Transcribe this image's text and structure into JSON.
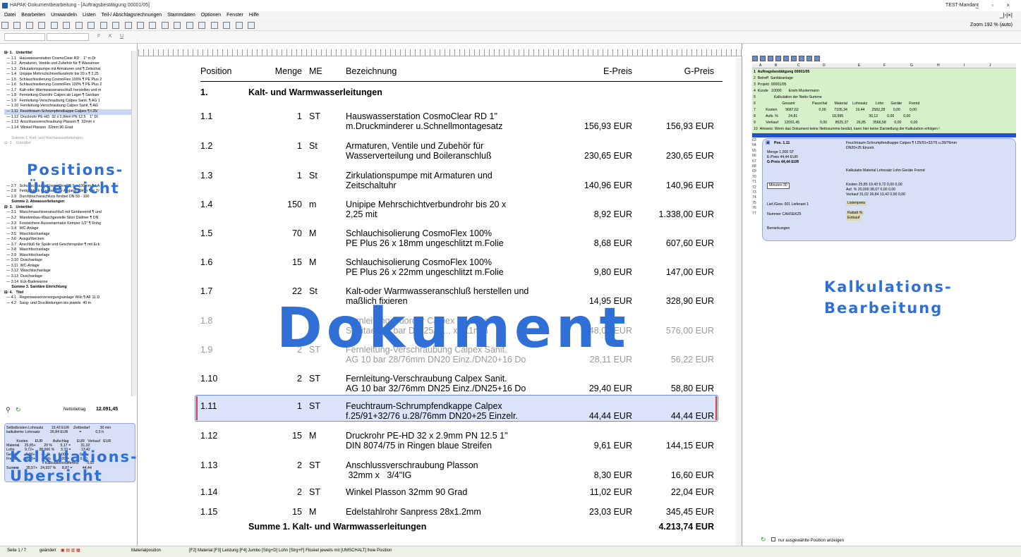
{
  "window": {
    "title": "HAPAK-Dokumentbearbeitung - [Auftragsbestätigung 00001/05]",
    "mandant": "TEST-Mandant",
    "controls": "_ ▫ ×"
  },
  "menu": {
    "items": [
      "Datei",
      "Bearbeiten",
      "Umwandeln",
      "Listen",
      "Teil-/ Abschlagsrechnungen",
      "Stammdaten",
      "Optionen",
      "Fenster",
      "Hilfe"
    ],
    "mdi_controls": "_|▫|×|"
  },
  "toolbar": {
    "zoom_label": "Zoom",
    "zoom_value": "192 % (auto)"
  },
  "format_toolbar": {
    "bold": "F",
    "italic": "K",
    "underline": "U"
  },
  "tree": {
    "rows": [
      {
        "text": "⊟· 1.   Untertitel",
        "style": "bold"
      },
      {
        "text": "  — 1.1   Hauswasserstation CosmoClear RD    1\" m.Dr",
        "style": ""
      },
      {
        "text": "  — 1.2   Armaturen, Ventile und Zubehör für ¶ Wasserver",
        "style": ""
      },
      {
        "text": "  — 1.3   Zirkulationspumpe mit Armaturen und ¶ Zeitschal",
        "style": ""
      },
      {
        "text": "  — 1.4   Unipipe Mehrschichtverbundrohr bis 20 x ¶ 2,25",
        "style": ""
      },
      {
        "text": "  — 1.5   Schlauchisolierung CosmoFlex 100% ¶ PE Plus 2",
        "style": ""
      },
      {
        "text": "  — 1.6   Schlauchisolierung CosmoFlex 100% ¶ PE Plus 2",
        "style": ""
      },
      {
        "text": "  — 1.7   Kalt-oder Warmwasseranschluß herstellen und m",
        "style": ""
      },
      {
        "text": "  — 1.8   Fernleitung-Duorohr Calpex ab Lager ¶ Sanitaer",
        "style": ""
      },
      {
        "text": "  — 1.9   Fernleitung-Verschraubung Calpex Sanit. ¶ AG 1",
        "style": ""
      },
      {
        "text": "  — 1.10  Fernleitung-Verschraubung Calpex Sanit. ¶ AG",
        "style": ""
      },
      {
        "text": "  — 1.11  Feuchtraum-Schrumpfendkappe Calpex ¶ f.25/",
        "style": "sel"
      },
      {
        "text": "  — 1.12  Druckrohr PE-HD  32 x 2,9mm PN 12.5    1\" DI",
        "style": ""
      },
      {
        "text": "  — 1.13  Anschlussverschraubung Plasson ¶  32mm x",
        "style": ""
      },
      {
        "text": "  — 1.14  Winkel Plasson  32mm 90 Grad",
        "style": ""
      },
      {
        "text": "",
        "style": ""
      },
      {
        "text": "       Summe 1. Kalt- und Warmwasserleitungen",
        "style": "grey"
      },
      {
        "text": "⊟· 2.   Untertitel",
        "style": "grey"
      },
      {
        "text": "",
        "style": ""
      },
      {
        "text": "",
        "style": ""
      },
      {
        "text": "",
        "style": ""
      },
      {
        "text": "",
        "style": ""
      },
      {
        "text": "",
        "style": ""
      },
      {
        "text": "",
        "style": ""
      },
      {
        "text": "",
        "style": ""
      },
      {
        "text": "  — 2.7   Schutzschlauch CosmoFlex PE 5 x 100mm ¶ LA",
        "style": ""
      },
      {
        "text": "  — 2.8   Fertigeblock f.Leckwasser Abgang 50mm ¶ m.Tr",
        "style": ""
      },
      {
        "text": "  — 2.9   Durchbruchanschluss flexibel DN 50 - 100",
        "style": ""
      },
      {
        "text": "       Summe 2. Abwasserleitungen",
        "style": "bold"
      },
      {
        "text": "⊟· 3.   Untertitel",
        "style": "bold"
      },
      {
        "text": "  — 3.1   Waschmaschinenanschluß mit Geräteventil ¶ und",
        "style": ""
      },
      {
        "text": "  — 3.2   Wandeinbau-Waschgestelle Silon Dallmer ¶ DN",
        "style": ""
      },
      {
        "text": "  — 3.3   Frostsichere Aussenarmatur Kemper 1/2\" ¶ Rohg",
        "style": ""
      },
      {
        "text": "  — 3.4   WC-Anlage",
        "style": ""
      },
      {
        "text": "  — 3.5   Waschtischanlage",
        "style": ""
      },
      {
        "text": "  — 3.6   Ausgußbecken",
        "style": ""
      },
      {
        "text": "  — 3.7   Anschluß für Spüle und Geschirrspüler ¶ mit Eck",
        "style": ""
      },
      {
        "text": "  — 3.8   Waschtischanlage",
        "style": ""
      },
      {
        "text": "  — 3.9   Waschtischanlage",
        "style": ""
      },
      {
        "text": "  — 3.10  Duschanlage",
        "style": ""
      },
      {
        "text": "  — 3.11  WC-Anlage",
        "style": ""
      },
      {
        "text": "  — 3.12  Waschtischanlage",
        "style": ""
      },
      {
        "text": "  — 3.13  Duschanlage",
        "style": ""
      },
      {
        "text": "  — 3.14  Eck-Badewanne",
        "style": ""
      },
      {
        "text": "       Summe 3. Sanitäre Einrichtung",
        "style": "bold"
      },
      {
        "text": "⊟· 4.   Titel",
        "style": "bold"
      },
      {
        "text": "  — 4.1   Regenwasserversorgungsanlage Wilo ¶ AF 11 D",
        "style": ""
      },
      {
        "text": "  — 4.2   Saug- und Druckleitungen bis jeweils  40 m",
        "style": ""
      }
    ]
  },
  "net": {
    "label": "Nettobetrag",
    "value": "12.091,45"
  },
  "kalk_overview": {
    "rows": [
      "Selbstkosten Lohnsatz        19,43 EUR    Zeitbedarf          30 min",
      "kalkulierter Lohnsatz          26,84 EUR           =              0,5 h",
      "",
      "          Kosten       EUR          Aufschlag        EUR   Verkauf   EUR",
      "Material     25,85+        20 %        5,17 =          31,02",
      "Lohn          9,72+     38,066 %      3,70 =          13,42",
      "Geräte        0,00+      ---- %        0,00 =           0,00",
      "Fremd         0,00+      ---- %        0,00 =           0,00",
      "                                   + Kalkulationsdifferenz        0,00",
      "Summe       35,57+   24,937 %      8,87 =          44,44"
    ]
  },
  "overlays": {
    "positions": "Positions-\nÜbersicht",
    "dokument": "Dokument",
    "kalk_ueber": "Kalkulations-\nÜbersicht",
    "kalk_bearb": "Kalkulations-\nBearbeitung"
  },
  "doc": {
    "headers": {
      "pos": "Position",
      "menge": "Menge",
      "me": "ME",
      "bez": "Bezeichnung",
      "ep": "E-Preis",
      "gp": "G-Preis"
    },
    "group_pos": "1.",
    "group_title": "Kalt- und Warmwasserleitungen",
    "rows": [
      {
        "pos": "1.1",
        "menge": "1",
        "me": "ST",
        "bez1": "Hauswasserstation CosmoClear RD     1\"",
        "bez2": "m.Druckminderer u.Schnellmontagesatz",
        "ep": "156,93 EUR",
        "gp": "156,93 EUR"
      },
      {
        "pos": "1.2",
        "menge": "1",
        "me": "St",
        "bez1": "Armaturen, Ventile und Zubehör für",
        "bez2": "Wasserverteilung und Boileranschluß",
        "ep": "230,65 EUR",
        "gp": "230,65 EUR"
      },
      {
        "pos": "1.3",
        "menge": "1",
        "me": "St",
        "bez1": "Zirkulationspumpe mit Armaturen und",
        "bez2": "Zeitschaltuhr",
        "ep": "140,96 EUR",
        "gp": "140,96 EUR"
      },
      {
        "pos": "1.4",
        "menge": "150",
        "me": "m",
        "bez1": "Unipipe Mehrschichtverbundrohr bis 20 x",
        "bez2": "2,25 mit",
        "ep": "8,92 EUR",
        "gp": "1.338,00 EUR"
      },
      {
        "pos": "1.5",
        "menge": "70",
        "me": "M",
        "bez1": "Schlauchisolierung CosmoFlex 100%",
        "bez2": "PE Plus 26 x 18mm ungeschlitzt m.Folie",
        "ep": "8,68 EUR",
        "gp": "607,60 EUR"
      },
      {
        "pos": "1.6",
        "menge": "15",
        "me": "M",
        "bez1": "Schlauchisolierung CosmoFlex 100%",
        "bez2": "PE Plus 26 x 22mm ungeschlitzt m.Folie",
        "ep": "9,80 EUR",
        "gp": "147,00 EUR"
      },
      {
        "pos": "1.7",
        "menge": "22",
        "me": "St",
        "bez1": "Kalt-oder Warmwasseranschluß herstellen und",
        "bez2": "maßlich fixieren",
        "ep": "14,95 EUR",
        "gp": "328,90 EUR"
      },
      {
        "pos": "1.8",
        "menge": "",
        "me": "M",
        "bez1": "Fernleitung-Duorohr Calpex ab Lager",
        "bez2": "Sanitaer 10 bar DN 25/2.... x 111mm",
        "ep": "48,00 EUR",
        "gp": "576,00 EUR",
        "faded": true
      },
      {
        "pos": "1.9",
        "menge": "2",
        "me": "ST",
        "bez1": "Fernleitung-Verschraubung Calpex Sanit.",
        "bez2": "AG 10 bar 28/76mm DN20 Einz./DN20+16 Do",
        "ep": "28,11 EUR",
        "gp": "56,22 EUR",
        "faded": true
      },
      {
        "pos": "1.10",
        "menge": "2",
        "me": "ST",
        "bez1": "Fernleitung-Verschraubung Calpex Sanit.",
        "bez2": "AG 10 bar 32/76mm DN25 Einz./DN25+16 Do",
        "ep": "29,40 EUR",
        "gp": "58,80 EUR"
      },
      {
        "pos": "1.11",
        "menge": "1",
        "me": "ST",
        "bez1": "Feuchtraum-Schrumpfendkappe Calpex",
        "bez2": "f.25/91+32/76 u.28/76mm DN20+25 Einzelr.",
        "ep": "44,44 EUR",
        "gp": "44,44 EUR"
      },
      {
        "pos": "1.12",
        "menge": "15",
        "me": "M",
        "bez1": "Druckrohr PE-HD  32 x 2.9mm PN 12.5     1\"",
        "bez2": "DIN 8074/75 in Ringen blaue Streifen",
        "ep": "9,61 EUR",
        "gp": "144,15 EUR"
      },
      {
        "pos": "1.13",
        "menge": "2",
        "me": "ST",
        "bez1": "Anschlussverschraubung Plasson",
        "bez2": " 32mm x   3/4\"IG",
        "ep": "8,30 EUR",
        "gp": "16,60 EUR"
      },
      {
        "pos": "1.14",
        "menge": "2",
        "me": "ST",
        "bez1": "Winkel Plasson  32mm 90 Grad",
        "bez2": "",
        "ep": "11,02 EUR",
        "gp": "22,04 EUR"
      },
      {
        "pos": "1.15",
        "menge": "15",
        "me": "M",
        "bez1": "Edelstahlrohr Sanpress 28x1.2mm",
        "bez2": "",
        "ep": "23,03 EUR",
        "gp": "345,45 EUR"
      }
    ],
    "sum_label": "Summe 1. Kalt- und Warmwasserleitungen",
    "sum_value": "4.213,74 EUR"
  },
  "sheet": {
    "col_letters": [
      "A",
      "B",
      "C",
      "D",
      "E",
      "F",
      "G",
      "H",
      "I",
      "J"
    ],
    "rows": [
      "1  Auftragsbestätigung 00001/05",
      "2  Betreff  Sanitäranlage",
      "3  Projekt  00001/05",
      "4  Kunde   10000       Erwin Mustermann",
      "5                  Kalkulation der Netto-Summe",
      "6                          Gesamt                 Pauschal       Material     Lohnsatz        Lohn       Geräte       Fremd",
      "7          Kosten        9687,62                    0,00        7105,34        19,44       2582,28        0,00         0,00",
      "8          Aufs. %          24,81                                  18,995                         30,12         0,00         0,00",
      "9          Verkauf      12091,45                    0,00        8525,37        26,85       3566,58        0,00         0,00",
      "10  Hinweis: Wenn das Dokument keine Nettosumme besitzt, kann hier keine Darstellung der Kalkulation erfolgen !"
    ]
  },
  "pane2": {
    "rownums": [
      "63",
      "64",
      "65",
      "66",
      "67",
      "68",
      "69",
      "70",
      "71",
      "72",
      "73",
      "74",
      "75",
      "76",
      "77"
    ],
    "pos_label": "Pos.  1.11",
    "desc": "Feuchtraum-Schrumpfendkappe Calpex ¶ f.25/91+32/76 u.28/76mm",
    "desc2": "DN20+25 Einzelr.",
    "menge": "Menge           1,000  ST",
    "epreis": "E-Preis            44,44  EUR",
    "gpreis": "G-Preis            44,44  EUR",
    "kalk_hdr": "Kalkulatio    Material    Lohnsatz      Lohn       Geräte      Fremd",
    "minuten": "Minuten                 30",
    "kosten": "Kosten        25,85       19,43        9,72         0,00         0,00",
    "aufs": "Auf. %        20,000                    38,07        0,00         0,00",
    "verkauf": "Verkauf       31,02       26,84       13,42         0,00         0,00",
    "lief": "Lief./Gew.    001 Lieferant 1",
    "nummer": "Nummer       CAHSEK25",
    "listenpreis": "Listenpreis",
    "rabatt": "Rabatt %",
    "einkauf": "Einkauf",
    "bemerkungen": "Bemerkungen"
  },
  "right_bottom": {
    "checkbox_label": "nur ausgewählte Position anzeigen"
  },
  "status": {
    "page": "Seite 1 / 7",
    "state": "geändert",
    "field": "Materialposition",
    "hints": "[F2] Material  [F3] Leistung  [F4] Jumbo  [Strg+D] Lohn  [Strg+F] Floskel    jeweils mit [UMSCHALT] freie Position"
  }
}
